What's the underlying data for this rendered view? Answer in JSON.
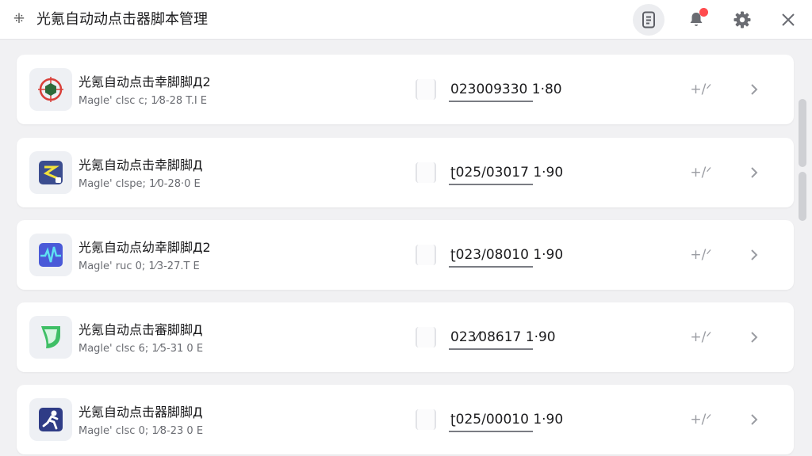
{
  "window": {
    "title": "光氪自动动点击器脚本管理",
    "app_icon": "asterisk-icon",
    "buttons": [
      {
        "icon": "document-icon",
        "active": true
      },
      {
        "icon": "bell-icon",
        "badge": true,
        "badge_color": "#ff4b4e"
      },
      {
        "icon": "gear-icon"
      },
      {
        "icon": "close-icon"
      }
    ]
  },
  "scripts": [
    {
      "name": "光氪自动点击幸脚脚Д2",
      "meta": "Magle' clsc c; 1⁄8-28 T.I E",
      "date": "023009330 1·80",
      "thumb": "target-icon",
      "thumb_color": "#d9403a",
      "edit_label": "+/ᐟ"
    },
    {
      "name": "光氪自动点击幸脚脚Д",
      "meta": "Magle' clspe; 1⁄0-28·0 E",
      "date": "ʈ025/03017 1·90",
      "thumb": "route-icon",
      "thumb_color": "#3b4d8f",
      "edit_label": "+/ᐟ"
    },
    {
      "name": "光氪自动点幼幸脚脚Д2",
      "meta": "Magle' ruc 0; 1⁄3-27.T E",
      "date": "ʈ023/08010 1·90",
      "thumb": "pulse-icon",
      "thumb_color": "#4a5ad8",
      "edit_label": "+/ᐟ"
    },
    {
      "name": "光氪自动点击審脚脚Д",
      "meta": "Magle' clsc 6; 1⁄5-31 0 E",
      "date": "023⁄08617 1·90",
      "thumb": "leaf-icon",
      "thumb_color": "#3fbf66",
      "edit_label": "+/ᐟ"
    },
    {
      "name": "光氪自动点击器脚脚Д",
      "meta": "Magle' clsc 0; 1⁄8-23 0 E",
      "date": "ʈ025/00010 1·90",
      "thumb": "runner-icon",
      "thumb_color": "#2f3c86",
      "edit_label": "+/ᐟ"
    }
  ],
  "icons": {
    "edit": "edit-icon",
    "chevron": "chevron-right-icon"
  }
}
